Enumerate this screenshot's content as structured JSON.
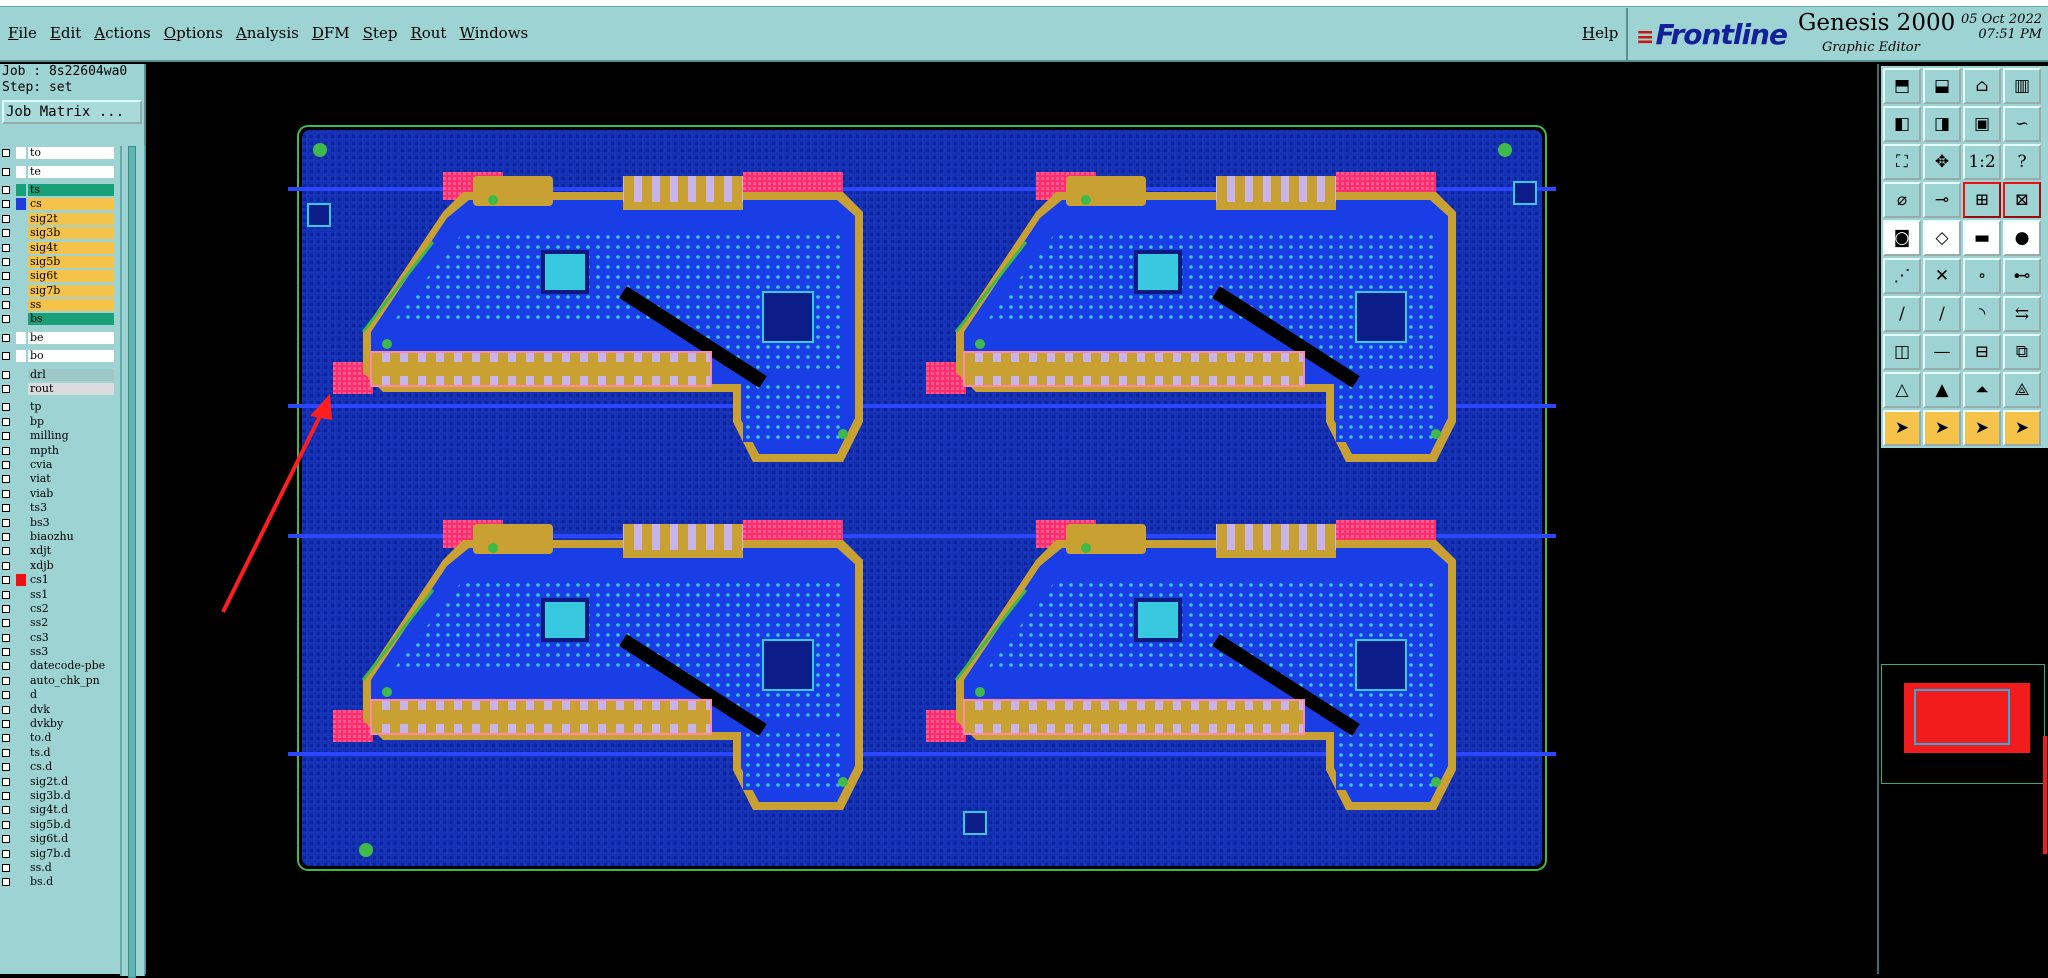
{
  "menu": {
    "items": [
      "File",
      "Edit",
      "Actions",
      "Options",
      "Analysis",
      "DFM",
      "Step",
      "Rout",
      "Windows"
    ],
    "help": "Help"
  },
  "brand": {
    "logo": "Frontline",
    "product": "Genesis 2000",
    "subtitle": "Graphic Editor",
    "date": "05 Oct 2022",
    "time": "07:51 PM"
  },
  "left_panel": {
    "job": "Job : 8s22604wa0",
    "step": "Step: set",
    "job_matrix": "Job Matrix ...",
    "layers": [
      {
        "name": "to",
        "color": "#ffffff",
        "bg": "#ffffff"
      },
      {
        "name": "te",
        "color": "#ffffff",
        "bg": "#ffffff",
        "gap": true
      },
      {
        "name": "ts",
        "color": "#1aa078",
        "bg": "#1aa078",
        "gap": true
      },
      {
        "name": "cs",
        "color": "#1e3cdc",
        "bg": "#f5c24a"
      },
      {
        "name": "sig2t",
        "color": "#9ed3d3",
        "bg": "#f5c24a"
      },
      {
        "name": "sig3b",
        "color": "#9ed3d3",
        "bg": "#f5c24a"
      },
      {
        "name": "sig4t",
        "color": "#9ed3d3",
        "bg": "#f5c24a"
      },
      {
        "name": "sig5b",
        "color": "#9ed3d3",
        "bg": "#f5c24a"
      },
      {
        "name": "sig6t",
        "color": "#9ed3d3",
        "bg": "#f5c24a"
      },
      {
        "name": "sig7b",
        "color": "#9ed3d3",
        "bg": "#f5c24a"
      },
      {
        "name": "ss",
        "color": "#9ed3d3",
        "bg": "#f5c24a"
      },
      {
        "name": "bs",
        "color": "#9ed3d3",
        "bg": "#1aa078"
      },
      {
        "name": "be",
        "color": "#ffffff",
        "bg": "#ffffff",
        "gap": true
      },
      {
        "name": "bo",
        "color": "#ffffff",
        "bg": "#ffffff",
        "gap": true
      },
      {
        "name": "drl",
        "color": "#9ed3d3",
        "bg": "#9fc8c8",
        "gap": true
      },
      {
        "name": "rout",
        "color": "#9ed3d3",
        "bg": "#dcdcdc"
      },
      {
        "name": "tp",
        "color": "#9ed3d3",
        "bg": "#9ed3d3",
        "gap": true
      },
      {
        "name": "bp",
        "color": "#9ed3d3",
        "bg": "#9ed3d3"
      },
      {
        "name": "milling",
        "color": "#9ed3d3",
        "bg": "#9ed3d3"
      },
      {
        "name": "mpth",
        "color": "#9ed3d3",
        "bg": "#9ed3d3"
      },
      {
        "name": "cvia",
        "color": "#9ed3d3",
        "bg": "#9ed3d3"
      },
      {
        "name": "viat",
        "color": "#9ed3d3",
        "bg": "#9ed3d3"
      },
      {
        "name": "viab",
        "color": "#9ed3d3",
        "bg": "#9ed3d3"
      },
      {
        "name": "ts3",
        "color": "#9ed3d3",
        "bg": "#9ed3d3"
      },
      {
        "name": "bs3",
        "color": "#9ed3d3",
        "bg": "#9ed3d3"
      },
      {
        "name": "biaozhu",
        "color": "#9ed3d3",
        "bg": "#9ed3d3"
      },
      {
        "name": "xdjt",
        "color": "#9ed3d3",
        "bg": "#9ed3d3"
      },
      {
        "name": "xdjb",
        "color": "#9ed3d3",
        "bg": "#9ed3d3"
      },
      {
        "name": "cs1",
        "color": "#e11",
        "bg": "#9ed3d3"
      },
      {
        "name": "ss1",
        "color": "#9ed3d3",
        "bg": "#9ed3d3"
      },
      {
        "name": "cs2",
        "color": "#9ed3d3",
        "bg": "#9ed3d3"
      },
      {
        "name": "ss2",
        "color": "#9ed3d3",
        "bg": "#9ed3d3"
      },
      {
        "name": "cs3",
        "color": "#9ed3d3",
        "bg": "#9ed3d3"
      },
      {
        "name": "ss3",
        "color": "#9ed3d3",
        "bg": "#9ed3d3"
      },
      {
        "name": "datecode-pbe",
        "color": "#9ed3d3",
        "bg": "#9ed3d3"
      },
      {
        "name": "auto_chk_pn",
        "color": "#9ed3d3",
        "bg": "#9ed3d3"
      },
      {
        "name": "d",
        "color": "#9ed3d3",
        "bg": "#9ed3d3"
      },
      {
        "name": "dvk",
        "color": "#9ed3d3",
        "bg": "#9ed3d3"
      },
      {
        "name": "dvkby",
        "color": "#9ed3d3",
        "bg": "#9ed3d3"
      },
      {
        "name": "to.d",
        "color": "#9ed3d3",
        "bg": "#9ed3d3"
      },
      {
        "name": "ts.d",
        "color": "#9ed3d3",
        "bg": "#9ed3d3"
      },
      {
        "name": "cs.d",
        "color": "#9ed3d3",
        "bg": "#9ed3d3"
      },
      {
        "name": "sig2t.d",
        "color": "#9ed3d3",
        "bg": "#9ed3d3"
      },
      {
        "name": "sig3b.d",
        "color": "#9ed3d3",
        "bg": "#9ed3d3"
      },
      {
        "name": "sig4t.d",
        "color": "#9ed3d3",
        "bg": "#9ed3d3"
      },
      {
        "name": "sig5b.d",
        "color": "#9ed3d3",
        "bg": "#9ed3d3"
      },
      {
        "name": "sig6t.d",
        "color": "#9ed3d3",
        "bg": "#9ed3d3"
      },
      {
        "name": "sig7b.d",
        "color": "#9ed3d3",
        "bg": "#9ed3d3"
      },
      {
        "name": "ss.d",
        "color": "#9ed3d3",
        "bg": "#9ed3d3"
      },
      {
        "name": "bs.d",
        "color": "#9ed3d3",
        "bg": "#9ed3d3"
      }
    ]
  },
  "toolbar": {
    "tools": [
      {
        "icon": "open-icon",
        "glyph": "⬒",
        "style": ""
      },
      {
        "icon": "save-icon",
        "glyph": "⬓",
        "style": ""
      },
      {
        "icon": "home-icon",
        "glyph": "⌂",
        "style": ""
      },
      {
        "icon": "layout-icon",
        "glyph": "▥",
        "style": ""
      },
      {
        "icon": "prev-icon",
        "glyph": "◧",
        "style": ""
      },
      {
        "icon": "next-icon",
        "glyph": "◨",
        "style": ""
      },
      {
        "icon": "frame-icon",
        "glyph": "▣",
        "style": ""
      },
      {
        "icon": "snap-icon",
        "glyph": "∽",
        "style": ""
      },
      {
        "icon": "zoom-fit-icon",
        "glyph": "⛶",
        "style": ""
      },
      {
        "icon": "pan-icon",
        "glyph": "✥",
        "style": ""
      },
      {
        "icon": "ratio-icon",
        "glyph": "1:2",
        "style": ""
      },
      {
        "icon": "help-icon",
        "glyph": "?",
        "style": ""
      },
      {
        "icon": "measure-icon",
        "glyph": "⌀",
        "style": ""
      },
      {
        "icon": "probe-icon",
        "glyph": "⊸",
        "style": ""
      },
      {
        "icon": "net-icon",
        "glyph": "⊞",
        "style": "red"
      },
      {
        "icon": "net2-icon",
        "glyph": "⊠",
        "style": "red"
      },
      {
        "icon": "select-box-icon",
        "glyph": "◙",
        "style": "white"
      },
      {
        "icon": "edit-shape-icon",
        "glyph": "◇",
        "style": "white"
      },
      {
        "icon": "line-icon",
        "glyph": "▬",
        "style": "white"
      },
      {
        "icon": "circle-icon",
        "glyph": "●",
        "style": "white"
      },
      {
        "icon": "connect-icon",
        "glyph": "⋰",
        "style": ""
      },
      {
        "icon": "cross-icon",
        "glyph": "✕",
        "style": ""
      },
      {
        "icon": "node-icon",
        "glyph": "∘",
        "style": ""
      },
      {
        "icon": "node-move-icon",
        "glyph": "⊷",
        "style": ""
      },
      {
        "icon": "draw-line-icon",
        "glyph": "∕",
        "style": ""
      },
      {
        "icon": "draw-line2-icon",
        "glyph": "∕",
        "style": ""
      },
      {
        "icon": "arc-icon",
        "glyph": "◝",
        "style": ""
      },
      {
        "icon": "flip-icon",
        "glyph": "⇆",
        "style": ""
      },
      {
        "icon": "pad-icon",
        "glyph": "◫",
        "style": ""
      },
      {
        "icon": "dash-icon",
        "glyph": "—",
        "style": ""
      },
      {
        "icon": "dim-icon",
        "glyph": "⊟",
        "style": ""
      },
      {
        "icon": "copy-icon",
        "glyph": "⧉",
        "style": ""
      },
      {
        "icon": "triangle-icon",
        "glyph": "△",
        "style": ""
      },
      {
        "icon": "triangle2-icon",
        "glyph": "▲",
        "style": ""
      },
      {
        "icon": "triangle3-icon",
        "glyph": "⏶",
        "style": ""
      },
      {
        "icon": "triangle4-icon",
        "glyph": "⟁",
        "style": ""
      },
      {
        "icon": "pointer-icon",
        "glyph": "➤",
        "style": "yellow"
      },
      {
        "icon": "pointer2-icon",
        "glyph": "➤",
        "style": "yellow"
      },
      {
        "icon": "pointer3-icon",
        "glyph": "➤",
        "style": "yellow"
      },
      {
        "icon": "pointer4-icon",
        "glyph": "➤",
        "style": "yellow"
      }
    ]
  },
  "colors": {
    "panel": "#9ed3d3",
    "substrate": "#1232b8",
    "trace": "#1e46f0",
    "gold": "#c9a032",
    "pink": "#ff3c78",
    "green": "#3fb94a"
  }
}
